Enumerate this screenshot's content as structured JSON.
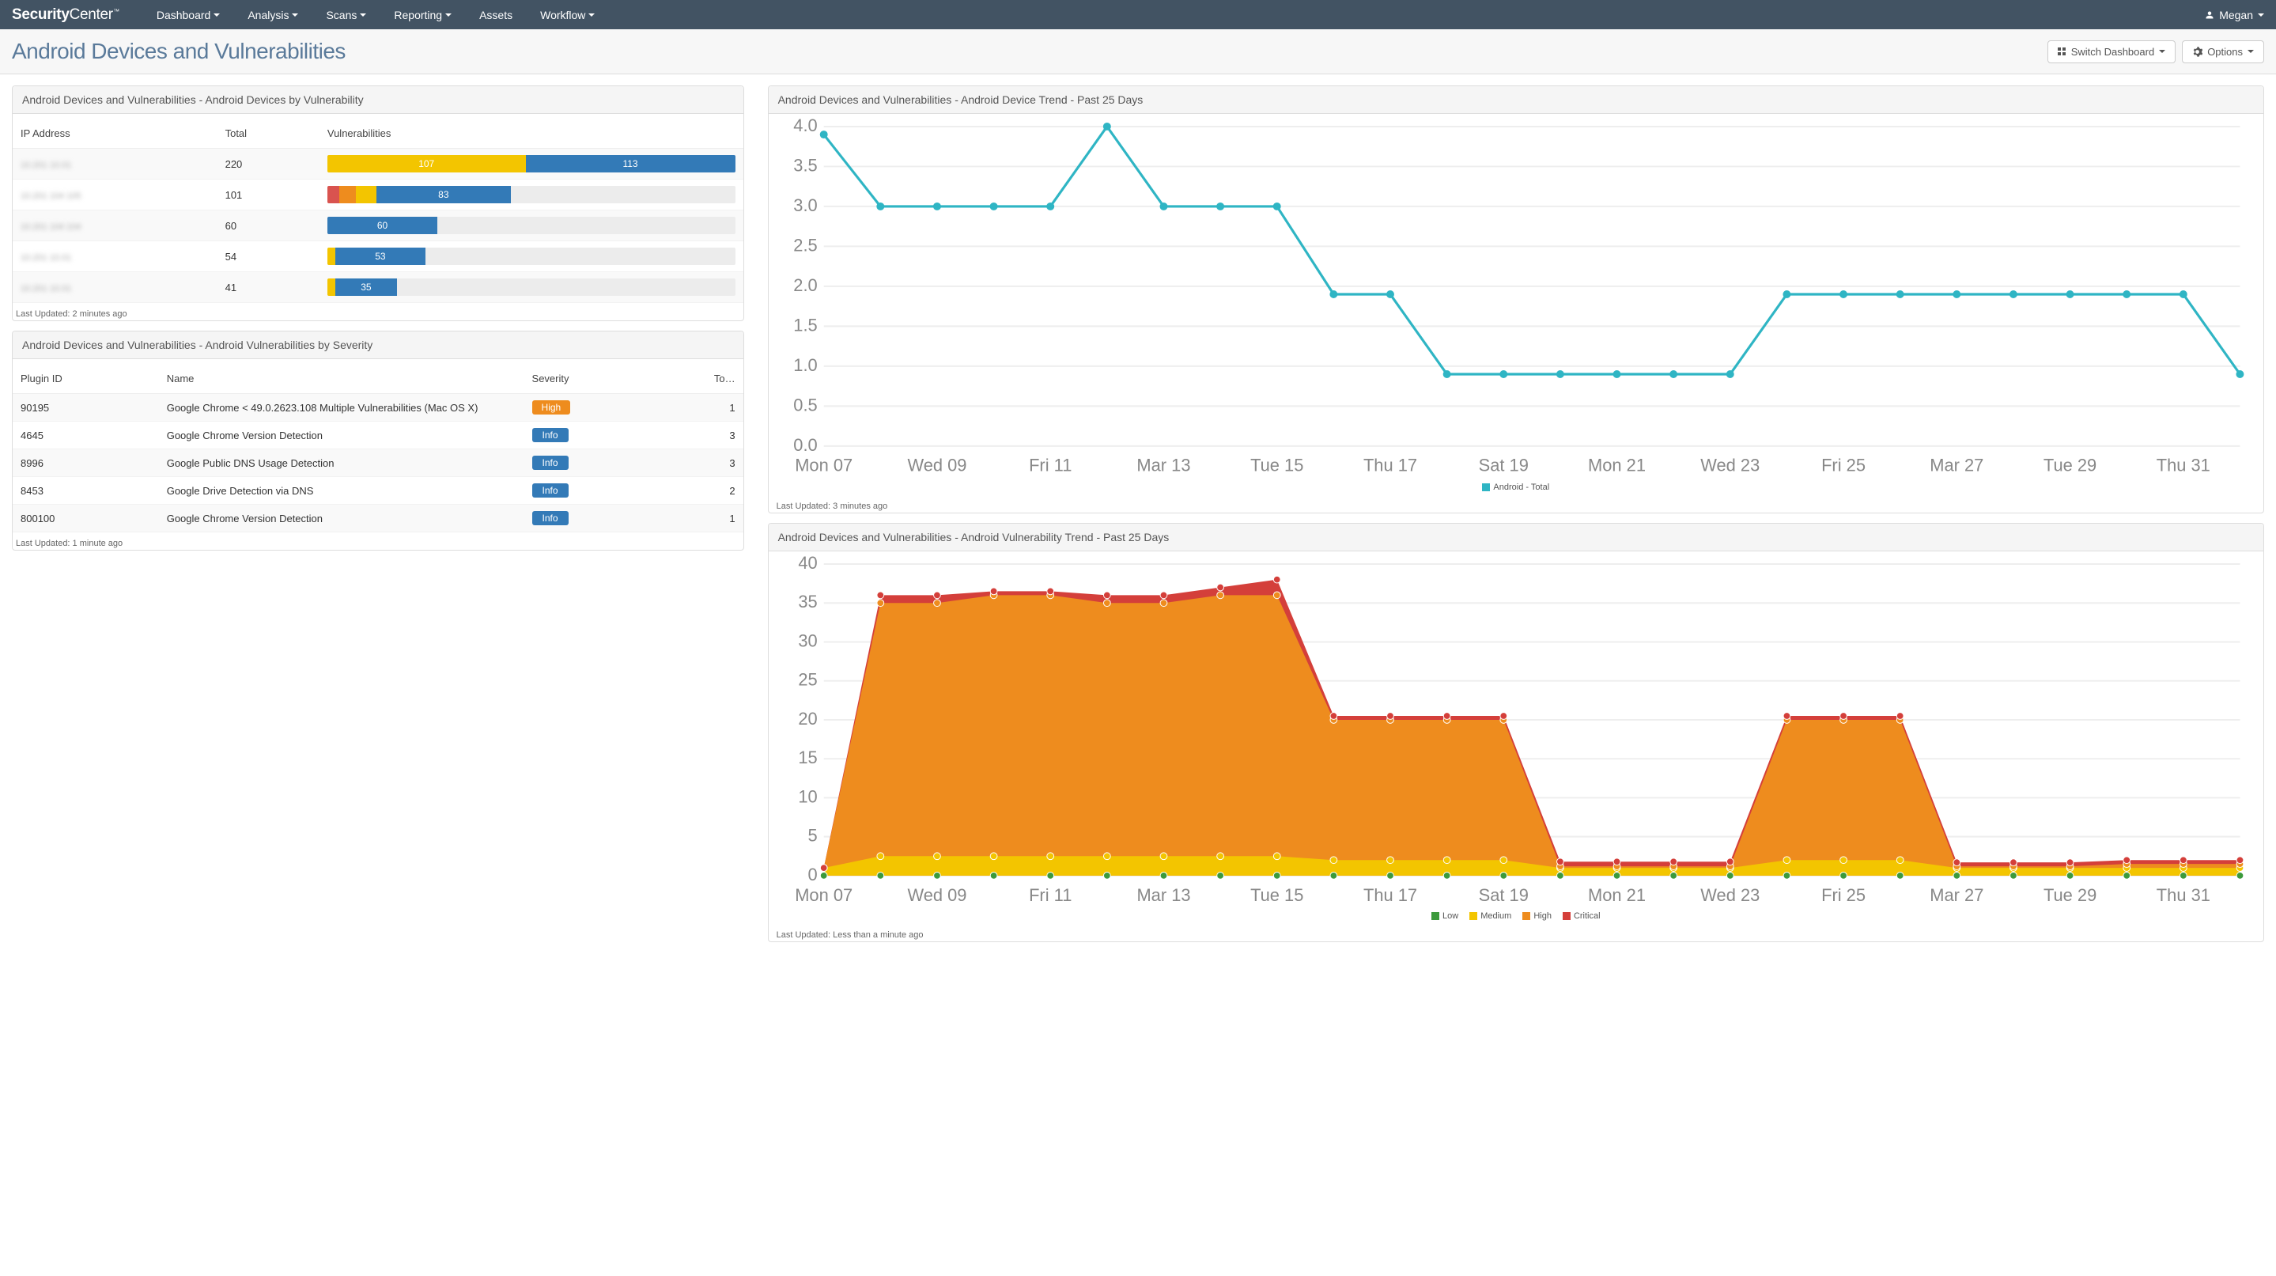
{
  "brand_a": "Security",
  "brand_b": "Center",
  "nav": [
    "Dashboard",
    "Analysis",
    "Scans",
    "Reporting",
    "Assets",
    "Workflow"
  ],
  "nav_has_caret": [
    true,
    true,
    true,
    true,
    false,
    true
  ],
  "user": "Megan",
  "page_title": "Android Devices and Vulnerabilities",
  "btn_switch": "Switch Dashboard",
  "btn_options": "Options",
  "panels": {
    "devices": {
      "title": "Android Devices and Vulnerabilities - Android Devices by Vulnerability",
      "cols": [
        "IP Address",
        "Total",
        "Vulnerabilities"
      ],
      "rows": [
        {
          "ip": "10.201 10.01",
          "total": 220,
          "segs": [
            [
              "yellow",
              107,
              48.6
            ],
            [
              "info",
              113,
              51.4
            ]
          ]
        },
        {
          "ip": "10.201 104 105",
          "total": 101,
          "segs": [
            [
              "crit",
              "",
              3
            ],
            [
              "high",
              "",
              4
            ],
            [
              "yellow",
              "",
              5
            ],
            [
              "info",
              83,
              33
            ]
          ]
        },
        {
          "ip": "10.201 104 104",
          "total": 60,
          "segs": [
            [
              "info",
              60,
              27
            ]
          ]
        },
        {
          "ip": "10.201 10.01",
          "total": 54,
          "segs": [
            [
              "yellow",
              "",
              2
            ],
            [
              "info",
              53,
              22
            ]
          ]
        },
        {
          "ip": "10.201 10.01",
          "total": 41,
          "segs": [
            [
              "yellow",
              "",
              2
            ],
            [
              "info",
              35,
              15
            ]
          ]
        }
      ],
      "updated": "Last Updated: 2 minutes ago"
    },
    "severity": {
      "title": "Android Devices and Vulnerabilities - Android Vulnerabilities by Severity",
      "cols": [
        "Plugin ID",
        "Name",
        "Severity",
        "To…"
      ],
      "rows": [
        {
          "id": "90195",
          "name": "Google Chrome < 49.0.2623.108 Multiple Vulnerabilities (Mac OS X)",
          "sev": "High",
          "sevc": "high",
          "tot": 1
        },
        {
          "id": "4645",
          "name": "Google Chrome Version Detection",
          "sev": "Info",
          "sevc": "info",
          "tot": 3
        },
        {
          "id": "8996",
          "name": "Google Public DNS Usage Detection",
          "sev": "Info",
          "sevc": "info",
          "tot": 3
        },
        {
          "id": "8453",
          "name": "Google Drive Detection via DNS",
          "sev": "Info",
          "sevc": "info",
          "tot": 2
        },
        {
          "id": "800100",
          "name": "Google Chrome Version Detection",
          "sev": "Info",
          "sevc": "info",
          "tot": 1
        }
      ],
      "updated": "Last Updated: 1 minute ago"
    },
    "trend_dev": {
      "title": "Android Devices and Vulnerabilities - Android Device Trend - Past 25 Days",
      "legend": "Android - Total",
      "updated": "Last Updated: 3 minutes ago"
    },
    "trend_vuln": {
      "title": "Android Devices and Vulnerabilities - Android Vulnerability Trend - Past 25 Days",
      "legend": [
        "Low",
        "Medium",
        "High",
        "Critical"
      ],
      "updated": "Last Updated: Less than a minute ago"
    }
  },
  "chart_data": [
    {
      "type": "line",
      "title": "Android Device Trend - Past 25 Days",
      "ylabel": "",
      "ylim": [
        0,
        4.0
      ],
      "yticks": [
        0,
        0.5,
        1.0,
        1.5,
        2.0,
        2.5,
        3.0,
        3.5,
        4.0
      ],
      "x_labels": [
        "Mon 07",
        "",
        "Wed 09",
        "",
        "Fri 11",
        "",
        "Mar 13",
        "",
        "Tue 15",
        "",
        "Thu 17",
        "",
        "Sat 19",
        "",
        "Mon 21",
        "",
        "Wed 23",
        "",
        "Fri 25",
        "",
        "Mar 27",
        "",
        "Tue 29",
        "",
        "Thu 31"
      ],
      "series": [
        {
          "name": "Android - Total",
          "color": "#2fb5c4",
          "values": [
            3.9,
            3.0,
            3.0,
            3.0,
            3.0,
            4.0,
            3.0,
            3.0,
            3.0,
            1.9,
            1.9,
            0.9,
            0.9,
            0.9,
            0.9,
            0.9,
            0.9,
            1.9,
            1.9,
            1.9,
            1.9,
            1.9,
            1.9,
            1.9,
            1.9,
            0.9
          ]
        }
      ]
    },
    {
      "type": "area",
      "title": "Android Vulnerability Trend - Past 25 Days",
      "ylim": [
        0,
        40
      ],
      "yticks": [
        0,
        5,
        10,
        15,
        20,
        25,
        30,
        35,
        40
      ],
      "x_labels": [
        "Mon 07",
        "",
        "Wed 09",
        "",
        "Fri 11",
        "",
        "Mar 13",
        "",
        "Tue 15",
        "",
        "Thu 17",
        "",
        "Sat 19",
        "",
        "Mon 21",
        "",
        "Wed 23",
        "",
        "Fri 25",
        "",
        "Mar 27",
        "",
        "Tue 29",
        "",
        "Thu 31"
      ],
      "series": [
        {
          "name": "Low",
          "color": "#3c9a3c",
          "values": [
            0,
            0,
            0,
            0,
            0,
            0,
            0,
            0,
            0,
            0,
            0,
            0,
            0,
            0,
            0,
            0,
            0,
            0,
            0,
            0,
            0,
            0,
            0,
            0,
            0,
            0
          ]
        },
        {
          "name": "Medium",
          "color": "#f3c500",
          "values": [
            1,
            2.5,
            2.5,
            2.5,
            2.5,
            2.5,
            2.5,
            2.5,
            2.5,
            2,
            2,
            2,
            2,
            1,
            1,
            1,
            1,
            2,
            2,
            2,
            1,
            1,
            1,
            1,
            1,
            1
          ]
        },
        {
          "name": "High",
          "color": "#ee8c1e",
          "values": [
            1,
            35,
            35,
            36,
            36,
            35,
            35,
            36,
            36,
            20,
            20,
            20,
            20,
            1.2,
            1.2,
            1.2,
            1.2,
            20,
            20,
            20,
            1.2,
            1.2,
            1.2,
            1.5,
            1.5,
            1.5
          ]
        },
        {
          "name": "Critical",
          "color": "#d43f3a",
          "values": [
            1,
            36,
            36,
            36.5,
            36.5,
            36,
            36,
            37,
            38,
            20.5,
            20.5,
            20.5,
            20.5,
            1.8,
            1.8,
            1.8,
            1.8,
            20.5,
            20.5,
            20.5,
            1.7,
            1.7,
            1.7,
            2,
            2,
            2
          ]
        }
      ]
    }
  ]
}
